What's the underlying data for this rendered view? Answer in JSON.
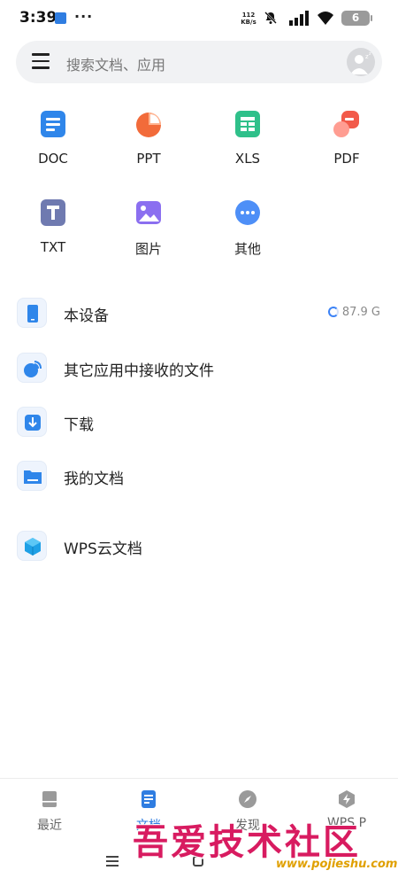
{
  "status_bar": {
    "time": "3:39",
    "dots": "···",
    "net_speed_value": "112",
    "net_speed_unit": "KB/s",
    "battery": "6"
  },
  "search": {
    "placeholder": "搜索文档、应用"
  },
  "file_types": [
    {
      "label": "DOC",
      "icon": "doc-icon",
      "color": "#2f86ea"
    },
    {
      "label": "PPT",
      "icon": "ppt-icon",
      "color": "#f26b3a"
    },
    {
      "label": "XLS",
      "icon": "xls-icon",
      "color": "#2fc08a"
    },
    {
      "label": "PDF",
      "icon": "pdf-icon",
      "color": "#f25a4a"
    },
    {
      "label": "TXT",
      "icon": "txt-icon",
      "color": "#6f7ab0"
    },
    {
      "label": "图片",
      "icon": "image-icon",
      "color": "#8b6ff0"
    },
    {
      "label": "其他",
      "icon": "more-icon",
      "color": "#4e8ff7"
    }
  ],
  "locations": [
    {
      "label": "本设备",
      "icon": "phone-icon",
      "meta": "87.9 G"
    },
    {
      "label": "其它应用中接收的文件",
      "icon": "received-files-icon",
      "meta": ""
    },
    {
      "label": "下载",
      "icon": "download-icon",
      "meta": ""
    },
    {
      "label": "我的文档",
      "icon": "folder-icon",
      "meta": ""
    },
    {
      "label": "WPS云文档",
      "icon": "cloud-cube-icon",
      "meta": ""
    }
  ],
  "bottom_nav": [
    {
      "label": "最近",
      "icon": "recent-icon",
      "active": false
    },
    {
      "label": "文档",
      "icon": "document-icon",
      "active": true
    },
    {
      "label": "发现",
      "icon": "compass-icon",
      "active": false
    },
    {
      "label": "WPS P",
      "icon": "bolt-icon",
      "active": false
    }
  ],
  "watermark": {
    "text": "吾爱技术社区",
    "url": "www.pojieshu.com"
  },
  "colors": {
    "accent": "#2f7de1"
  }
}
